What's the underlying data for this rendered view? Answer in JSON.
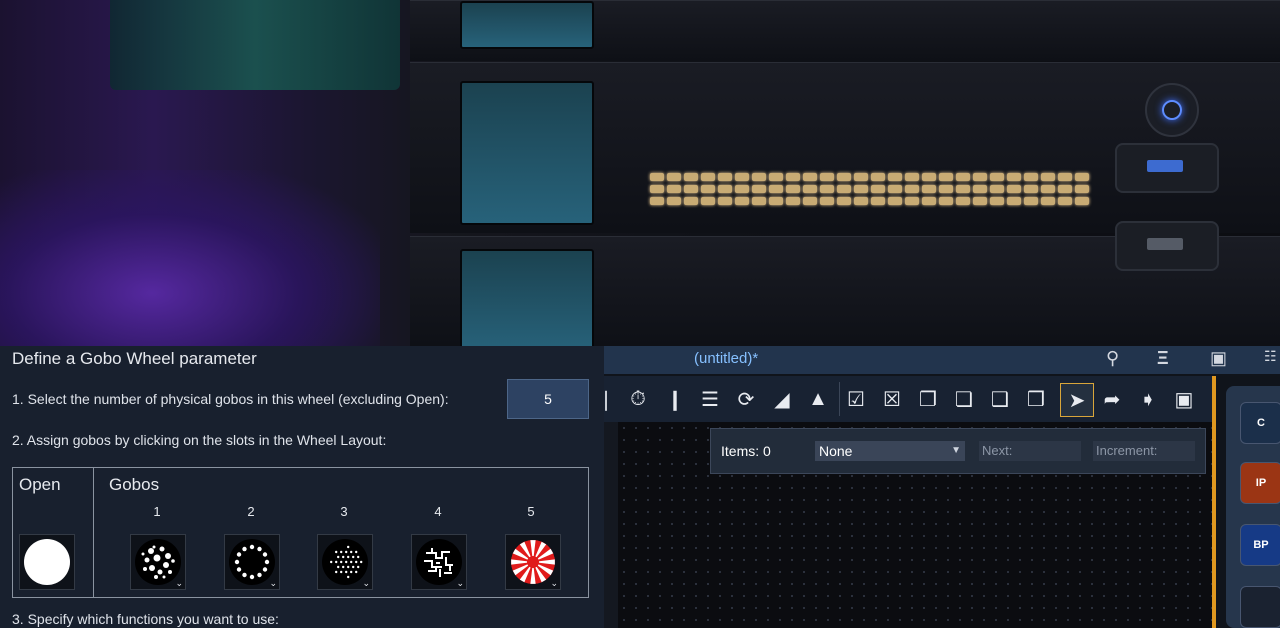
{
  "dialog": {
    "title": "Define a Gobo Wheel parameter",
    "step1": "1. Select the number of physical gobos in this wheel (excluding Open):",
    "gobo_count": "5",
    "step2": "2. Assign gobos by clicking on the slots in the Wheel Layout:",
    "open_label": "Open",
    "gobos_label": "Gobos",
    "gobos": [
      {
        "number": "1",
        "pattern": "splatter"
      },
      {
        "number": "2",
        "pattern": "dot-ring"
      },
      {
        "number": "3",
        "pattern": "dot-field"
      },
      {
        "number": "4",
        "pattern": "maze"
      },
      {
        "number": "5",
        "pattern": "red-star"
      }
    ],
    "step3": "3. Specify which functions you want to use:"
  },
  "app": {
    "title": "(untitled)*",
    "titlebar_icons": [
      "wand-icon",
      "fixture-icon",
      "camera-icon",
      "grid-icon"
    ],
    "toolbar_icons": [
      "gauge-icon",
      "align-vertical-icon",
      "list-icon",
      "rotate-icon",
      "flip-horizontal-icon",
      "mirror-icon",
      "select-all-icon",
      "deselect-icon",
      "copy-frame-icon",
      "stack-icon",
      "duplicate-icon",
      "bring-front-icon",
      "pointer-icon",
      "pointer-add-icon",
      "pointer-info-icon",
      "fit-frame-icon"
    ],
    "infobar": {
      "items": "Items: 0",
      "selection": "None",
      "next_placeholder": "Next:",
      "increment_placeholder": "Increment:"
    },
    "panel_buttons": [
      {
        "label": "C",
        "color": "#1b2f4a"
      },
      {
        "label": "IP",
        "color": "#9b3514"
      },
      {
        "label": "BP",
        "color": "#163a86"
      }
    ]
  },
  "colors": {
    "accent_orange": "#e09820",
    "title_blue": "#86c0ff",
    "gobo_red": "#e01b1b"
  }
}
